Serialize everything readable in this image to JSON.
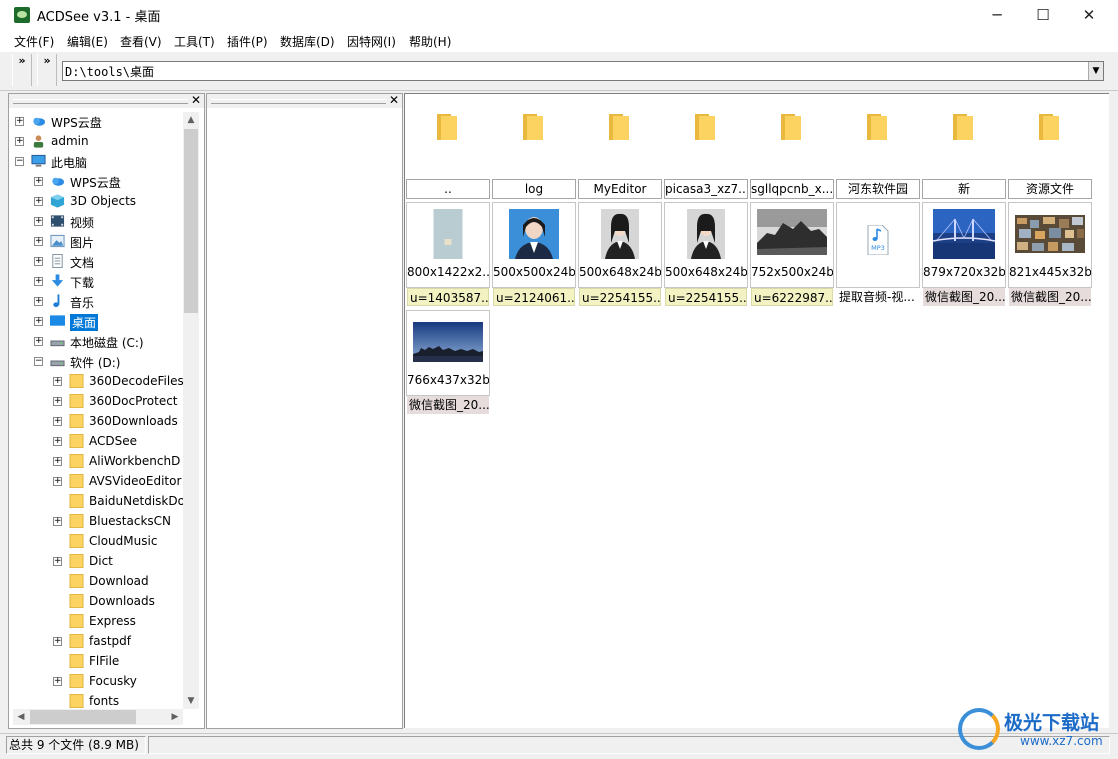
{
  "window": {
    "title": "ACDSee v3.1 - 桌面",
    "controls": [
      "─",
      "☐",
      "✕"
    ]
  },
  "menu": [
    "文件(F)",
    "编辑(E)",
    "查看(V)",
    "工具(T)",
    "插件(P)",
    "数据库(D)",
    "因特网(I)",
    "帮助(H)"
  ],
  "toolbar": {
    "chevron": "»",
    "address": "D:\\tools\\桌面",
    "dropdown": "▼"
  },
  "panes": {
    "close": "✕"
  },
  "tree": [
    {
      "label": "WPS云盘",
      "icon": "cloud-icon",
      "expander": "+"
    },
    {
      "label": "admin",
      "icon": "user-icon",
      "expander": "+"
    },
    {
      "label": "此电脑",
      "icon": "computer-icon",
      "expander": "−"
    },
    {
      "label": "WPS云盘",
      "icon": "cloud-icon",
      "expander": "+"
    },
    {
      "label": "3D Objects",
      "icon": "cube-icon",
      "expander": "+"
    },
    {
      "label": "视频",
      "icon": "video-icon",
      "expander": "+"
    },
    {
      "label": "图片",
      "icon": "picture-icon",
      "expander": "+"
    },
    {
      "label": "文档",
      "icon": "document-icon",
      "expander": "+"
    },
    {
      "label": "下载",
      "icon": "download-icon",
      "expander": "+"
    },
    {
      "label": "音乐",
      "icon": "music-icon",
      "expander": "+"
    },
    {
      "label": "桌面",
      "icon": "desktop-icon",
      "expander": "+",
      "selected": true
    },
    {
      "label": "本地磁盘 (C:)",
      "icon": "drive-icon",
      "expander": "+"
    },
    {
      "label": "软件 (D:)",
      "icon": "drive-icon",
      "expander": "−"
    },
    {
      "label": "360DecodeFiles",
      "icon": "folder-icon",
      "expander": "+"
    },
    {
      "label": "360DocProtect",
      "icon": "folder-icon",
      "expander": "+"
    },
    {
      "label": "360Downloads",
      "icon": "folder-icon",
      "expander": "+"
    },
    {
      "label": "ACDSee",
      "icon": "folder-icon",
      "expander": "+"
    },
    {
      "label": "AliWorkbenchD",
      "icon": "folder-icon",
      "expander": "+"
    },
    {
      "label": "AVSVideoEditor",
      "icon": "folder-icon",
      "expander": "+"
    },
    {
      "label": "BaiduNetdiskDo",
      "icon": "folder-icon",
      "expander": ""
    },
    {
      "label": "BluestacksCN",
      "icon": "folder-icon",
      "expander": "+"
    },
    {
      "label": "CloudMusic",
      "icon": "folder-icon",
      "expander": ""
    },
    {
      "label": "Dict",
      "icon": "folder-icon",
      "expander": "+"
    },
    {
      "label": "Download",
      "icon": "folder-icon",
      "expander": ""
    },
    {
      "label": "Downloads",
      "icon": "folder-icon",
      "expander": ""
    },
    {
      "label": "Express",
      "icon": "folder-icon",
      "expander": ""
    },
    {
      "label": "fastpdf",
      "icon": "folder-icon",
      "expander": "+"
    },
    {
      "label": "FlFile",
      "icon": "folder-icon",
      "expander": ""
    },
    {
      "label": "Focusky",
      "icon": "folder-icon",
      "expander": "+"
    },
    {
      "label": "fonts",
      "icon": "folder-icon",
      "expander": ""
    }
  ],
  "folders": [
    "..",
    "log",
    "MyEditor",
    "picasa3_xz7....",
    "sgllqpcnb_x...",
    "河东软件园",
    "新",
    "资源文件"
  ],
  "files": [
    {
      "dims": "800x1422x2...",
      "info": "u=1403587...",
      "info_style": "u",
      "thumb": "phone-wallpaper"
    },
    {
      "dims": "500x500x24b",
      "info": "u=2124061...",
      "info_style": "u",
      "thumb": "portrait-blue"
    },
    {
      "dims": "500x648x24b",
      "info": "u=2254155...",
      "info_style": "u",
      "thumb": "portrait-gray"
    },
    {
      "dims": "500x648x24b",
      "info": "u=2254155...",
      "info_style": "u",
      "thumb": "portrait-gray"
    },
    {
      "dims": "752x500x24b",
      "info": "u=6222987...",
      "info_style": "u",
      "thumb": "rock-bw"
    },
    {
      "dims": "",
      "info": "提取音频-视...",
      "info_style": "n",
      "thumb": "mp3-icon",
      "mp3_label": "MP3"
    },
    {
      "dims": "879x720x32b",
      "info": "微信截图_20...",
      "info_style": "w",
      "thumb": "bridge-night"
    },
    {
      "dims": "821x445x32b",
      "info": "微信截图_20...",
      "info_style": "w",
      "thumb": "city-aerial"
    },
    {
      "dims": "766x437x32b",
      "info": "微信截图_20...",
      "info_style": "w",
      "thumb": "skyline-dusk"
    }
  ],
  "status": {
    "text": "总共 9 个文件 (8.9 MB)"
  },
  "watermark": {
    "title": "极光下载站",
    "url": "www.xz7.com"
  },
  "colors": {
    "selection": "#0078d7",
    "folder": "#fcd260",
    "info_u_bg": "#f2f2c2",
    "info_w_bg": "#e6dcdc"
  }
}
